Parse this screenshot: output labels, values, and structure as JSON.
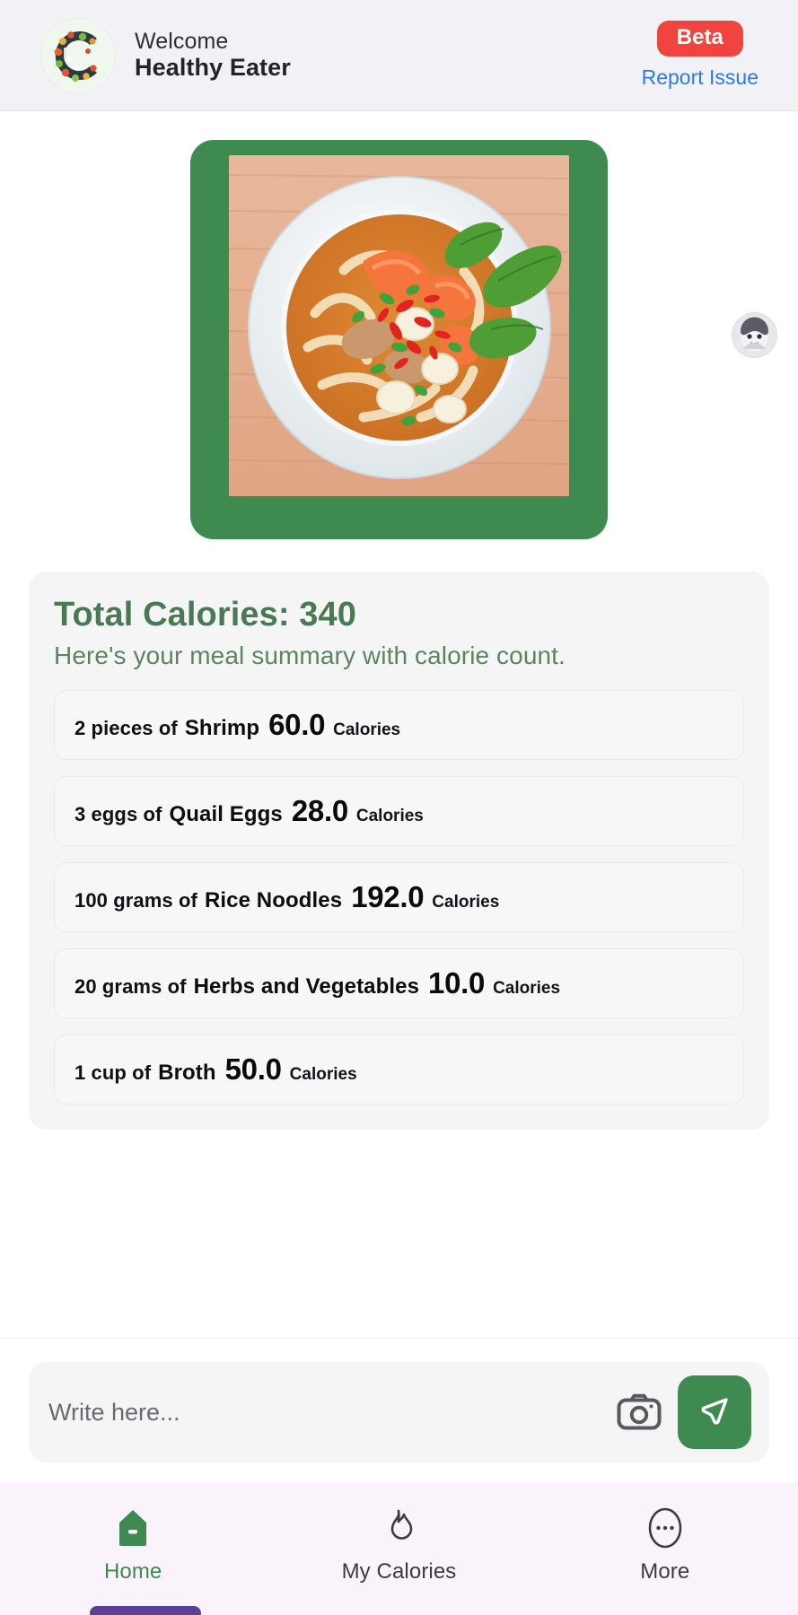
{
  "header": {
    "logo_icon": "vegetable-letter-c-logo",
    "welcome_label": "Welcome",
    "brand_name": "Healthy Eater",
    "beta_label": "Beta",
    "report_issue_label": "Report Issue",
    "badge_color": "#f0453f",
    "link_color": "#2a7ce0",
    "background": "#f2f1f5"
  },
  "meal": {
    "photo_alt": "noodle-soup-bowl-with-shrimp-and-quail-eggs",
    "card_color": "#3f8a50",
    "avatar_alt": "user-avatar"
  },
  "summary": {
    "total_label": "Total Calories: 340",
    "total_value": 340,
    "subtitle": "Here's your meal summary with calorie count.",
    "heading_color": "#4a7a52",
    "items": [
      {
        "qty": "2 pieces of",
        "name": "Shrimp",
        "value": "60.0",
        "unit": "Calories"
      },
      {
        "qty": "3 eggs of",
        "name": "Quail Eggs",
        "value": "28.0",
        "unit": "Calories"
      },
      {
        "qty": "100 grams of",
        "name": "Rice Noodles",
        "value": "192.0",
        "unit": "Calories"
      },
      {
        "qty": "20 grams of",
        "name": "Herbs and Vegetables",
        "value": "10.0",
        "unit": "Calories"
      },
      {
        "qty": "1 cup of",
        "name": "Broth",
        "value": "50.0",
        "unit": "Calories"
      }
    ]
  },
  "composer": {
    "placeholder": "Write here...",
    "value": "",
    "camera_icon": "camera-icon",
    "send_icon": "send-icon",
    "send_color": "#3f8a50"
  },
  "bottom_nav": {
    "background": "#fbf3fb",
    "active_color": "#3f8a50",
    "items": [
      {
        "label": "Home",
        "icon": "home-icon",
        "active": true
      },
      {
        "label": "My Calories",
        "icon": "flame-icon",
        "active": false
      },
      {
        "label": "More",
        "icon": "ellipsis-circle-icon",
        "active": false
      }
    ]
  }
}
